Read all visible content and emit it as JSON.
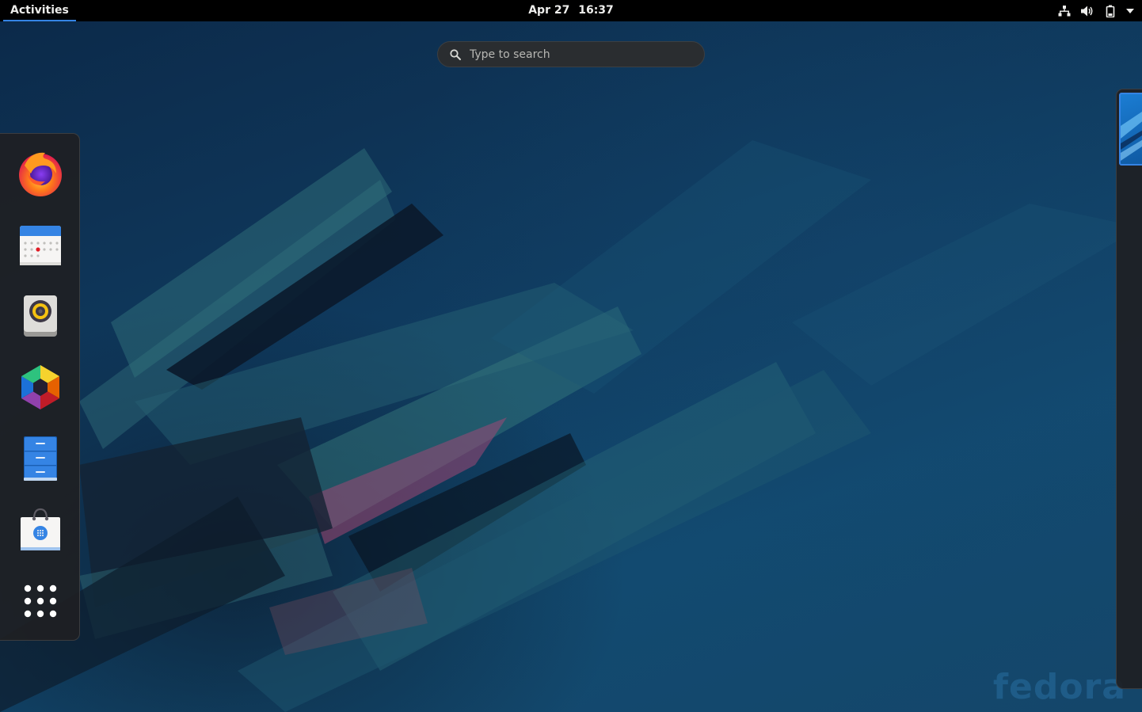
{
  "topbar": {
    "activities_label": "Activities",
    "date": "Apr 27",
    "time": "16:37",
    "status_icons": [
      "network-wired-icon",
      "volume-icon",
      "battery-icon",
      "system-menu-arrow-icon"
    ]
  },
  "search": {
    "placeholder": "Type to search"
  },
  "dash": {
    "apps": [
      {
        "name": "Firefox",
        "icon": "firefox-icon"
      },
      {
        "name": "Calendar",
        "icon": "calendar-icon"
      },
      {
        "name": "Rhythmbox",
        "icon": "rhythmbox-icon"
      },
      {
        "name": "Photos",
        "icon": "photos-icon"
      },
      {
        "name": "Files",
        "icon": "files-icon"
      },
      {
        "name": "Software",
        "icon": "software-icon"
      },
      {
        "name": "Show Applications",
        "icon": "app-grid-icon"
      }
    ]
  },
  "wallpaper": {
    "watermark": "fedora"
  },
  "colors": {
    "accent": "#3584e4",
    "topbar_bg": "#000000",
    "dash_bg": "#1e2023",
    "wallpaper_base": "#0f3a5e"
  }
}
